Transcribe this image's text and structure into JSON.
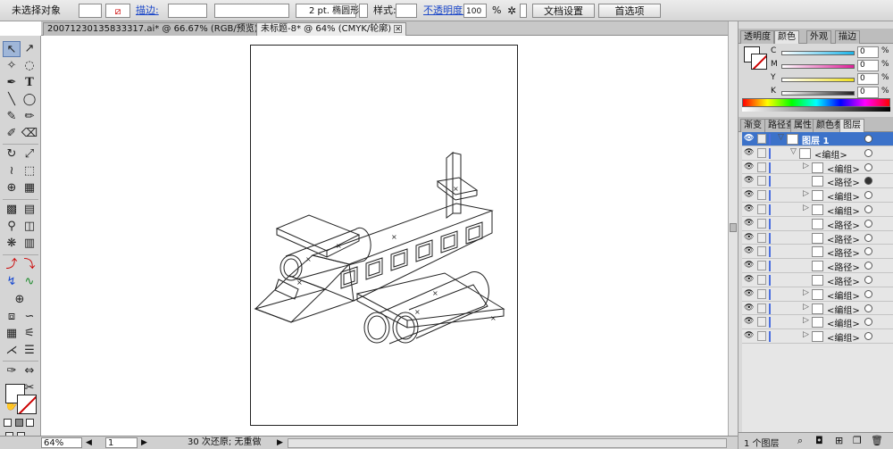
{
  "control": {
    "selection_status": "未选择对象",
    "stroke_label": "描边:",
    "stroke_weight": "2 pt. 椭圆形",
    "style_label": "样式:",
    "opacity_label": "不透明度:",
    "opacity_value": "100",
    "opacity_unit": "%",
    "doc_setup_button": "文档设置",
    "prefs_button": "首选项"
  },
  "doc_tabs": [
    {
      "label": "20071230135833317.ai* @ 66.67% (RGB/预览)",
      "active": false
    },
    {
      "label": "未标题-8* @ 64% (CMYK/轮廓)",
      "active": true
    }
  ],
  "status": {
    "zoom": "64%",
    "page": "1",
    "undo": "30 次还原; 无重做"
  },
  "color_panel": {
    "tabs": [
      "透明度",
      "颜色",
      "外观",
      "描边"
    ],
    "active_tab": "颜色",
    "channels": [
      {
        "key": "C",
        "value": "0",
        "unit": "%",
        "color": "#1ab3e8"
      },
      {
        "key": "M",
        "value": "0",
        "unit": "%",
        "color": "#e0209a"
      },
      {
        "key": "Y",
        "value": "0",
        "unit": "%",
        "color": "#f0e020"
      },
      {
        "key": "K",
        "value": "0",
        "unit": "%",
        "color": "#222222"
      }
    ]
  },
  "layers_panel": {
    "tabs": [
      "渐变",
      "路径查",
      "属性",
      "颜色参",
      "图层"
    ],
    "active_tab": "图层",
    "rows": [
      {
        "label": "图层 1",
        "level": 0,
        "twisty": "open",
        "target": "ring",
        "top": true
      },
      {
        "label": "<编组>",
        "level": 1,
        "twisty": "open",
        "target": "ring"
      },
      {
        "label": "<编组>",
        "level": 2,
        "twisty": "closed",
        "target": "ring"
      },
      {
        "label": "<路径>",
        "level": 2,
        "twisty": "",
        "target": "fill"
      },
      {
        "label": "<编组>",
        "level": 2,
        "twisty": "closed",
        "target": "ring"
      },
      {
        "label": "<编组>",
        "level": 2,
        "twisty": "closed",
        "target": "ring"
      },
      {
        "label": "<路径>",
        "level": 2,
        "twisty": "",
        "target": "ring"
      },
      {
        "label": "<路径>",
        "level": 2,
        "twisty": "",
        "target": "ring"
      },
      {
        "label": "<路径>",
        "level": 2,
        "twisty": "",
        "target": "ring"
      },
      {
        "label": "<路径>",
        "level": 2,
        "twisty": "",
        "target": "ring"
      },
      {
        "label": "<路径>",
        "level": 2,
        "twisty": "",
        "target": "ring"
      },
      {
        "label": "<编组>",
        "level": 2,
        "twisty": "closed",
        "target": "ring"
      },
      {
        "label": "<编组>",
        "level": 2,
        "twisty": "closed",
        "target": "ring"
      },
      {
        "label": "<编组>",
        "level": 2,
        "twisty": "closed",
        "target": "ring"
      },
      {
        "label": "<编组>",
        "level": 2,
        "twisty": "closed",
        "target": "ring"
      }
    ],
    "footer": "1 个图层"
  }
}
